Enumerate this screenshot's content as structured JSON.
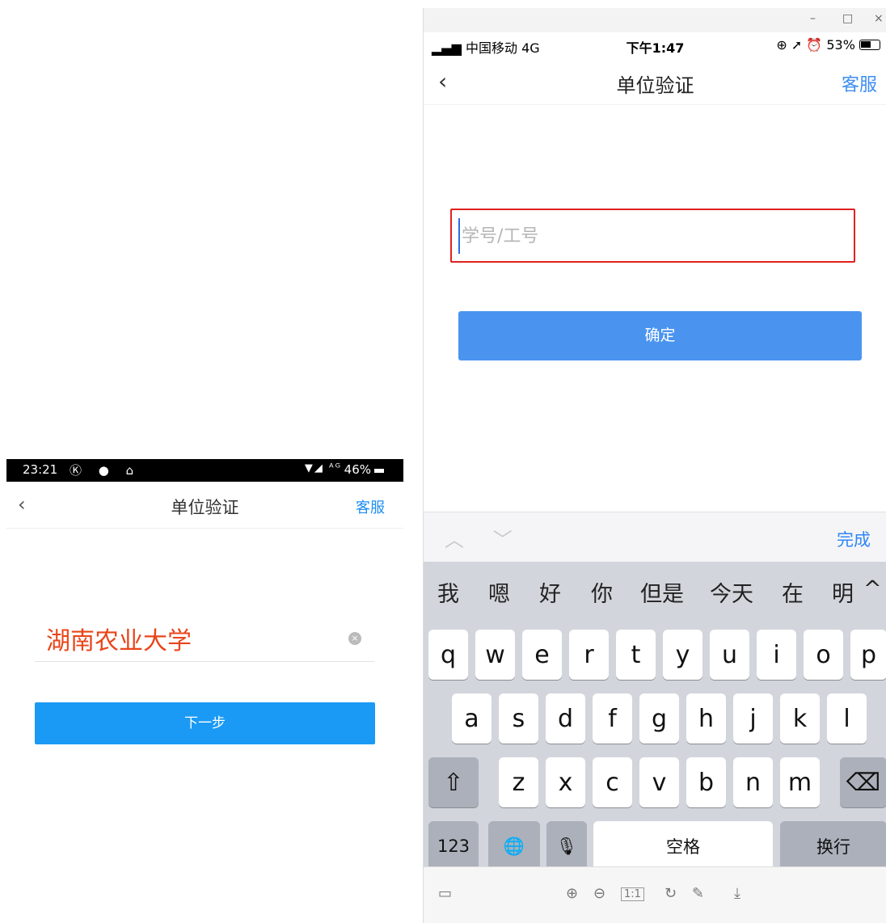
{
  "left_phone": {
    "status": {
      "time": "23:21",
      "left_icons": "Ⓚ ● ⌂",
      "right_icons": "▼◢ ᴬᴳ",
      "battery": "46%"
    },
    "nav": {
      "back": "‹",
      "title": "单位验证",
      "service": "客服"
    },
    "field": {
      "value": "湖南农业大学",
      "clear": "×"
    },
    "next_button": "下一步"
  },
  "right_window": {
    "window_controls": {
      "minimize": "–",
      "maximize": "□",
      "close": "×"
    },
    "status": {
      "signal": "▂▄▆ 中国移动  4G",
      "time": "下午1:47",
      "right": "⊕ ➚ ⏰ 53%"
    },
    "nav": {
      "back": "‹",
      "title": "单位验证",
      "service": "客服"
    },
    "id_field": {
      "placeholder": "学号/工号",
      "value": ""
    },
    "confirm_button": "确定",
    "keyboard_toolbar": {
      "arrows": "︿ ﹀",
      "done": "完成"
    },
    "candidates": [
      "我",
      "嗯",
      "好",
      "你",
      "但是",
      "今天",
      "在",
      "明",
      "^"
    ],
    "row1": [
      "q",
      "w",
      "e",
      "r",
      "t",
      "y",
      "u",
      "i",
      "o",
      "p"
    ],
    "row2": [
      "a",
      "s",
      "d",
      "f",
      "g",
      "h",
      "j",
      "k",
      "l"
    ],
    "row3": [
      "z",
      "x",
      "c",
      "v",
      "b",
      "n",
      "m"
    ],
    "shift": "⇧",
    "delete": "⌫",
    "num_key": "123",
    "globe": "🌐",
    "mic": "🎙",
    "space": "空格",
    "return": "换行",
    "bottom_tools": [
      "▭",
      "⊕",
      "⊖",
      "1:1",
      "↻",
      "✎",
      "⤓"
    ]
  }
}
